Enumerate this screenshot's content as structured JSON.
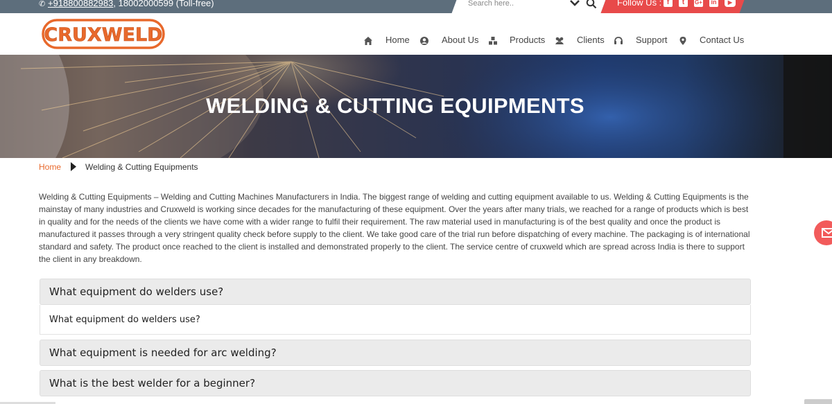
{
  "topbar": {
    "phone_primary": "+918800882983",
    "phone_secondary": ", 18002000599 (Toll-free)",
    "search_placeholder": "Search here..",
    "follow_label": "Follow Us :",
    "social": [
      {
        "name": "facebook-icon",
        "glyph": "f"
      },
      {
        "name": "twitter-icon",
        "glyph": "t"
      },
      {
        "name": "google-plus-icon",
        "glyph": "G+"
      },
      {
        "name": "linkedin-icon",
        "glyph": "in"
      },
      {
        "name": "youtube-icon",
        "glyph": "▶"
      }
    ]
  },
  "header": {
    "logo_text": "CRUXWELD",
    "nav": [
      {
        "label": "Home",
        "icon": "home-icon"
      },
      {
        "label": "About Us",
        "icon": "user-circle-icon"
      },
      {
        "label": "Products",
        "icon": "cubes-icon"
      },
      {
        "label": "Clients",
        "icon": "users-icon"
      },
      {
        "label": "Support",
        "icon": "headset-icon"
      },
      {
        "label": "Contact Us",
        "icon": "map-marker-icon"
      }
    ]
  },
  "banner": {
    "title": "WELDING & CUTTING EQUIPMENTS"
  },
  "breadcrumb": {
    "home": "Home",
    "current": "Welding & Cutting Equipments"
  },
  "intro": "Welding & Cutting Equipments – Welding and Cutting Machines Manufacturers in India. The biggest range of welding and cutting equipment available to us. Welding & Cutting Equipments is the mainstay of many industries and Cruxweld is working since decades for the manufacturing of these equipment. Over the years after many trials, we reached for a range of products which is best in quality and for the needs of the clients we have come with a wider range to fulfil their requirement. The raw material used in manufacturing is of the best quality and once the product is manufactured it passes through a very stringent quality check before supply to the client. We take good care of the trial run before dispatching of every machine. The packaging is of international standard and safety. The product once reached to the client is installed and demonstrated properly to the client. The service centre of cruxweld which are spread across India is there to support the client in any breakdown.",
  "faq": [
    {
      "question": "What equipment do welders use?",
      "answer": "What equipment do welders use?",
      "expanded": true
    },
    {
      "question": "What equipment is needed for arc welding?",
      "expanded": false
    },
    {
      "question": "What is the best welder for a beginner?",
      "expanded": false
    }
  ],
  "colors": {
    "accent": "#e8692c",
    "topbar": "#5d6e7c",
    "follow": "#e84a4a"
  }
}
